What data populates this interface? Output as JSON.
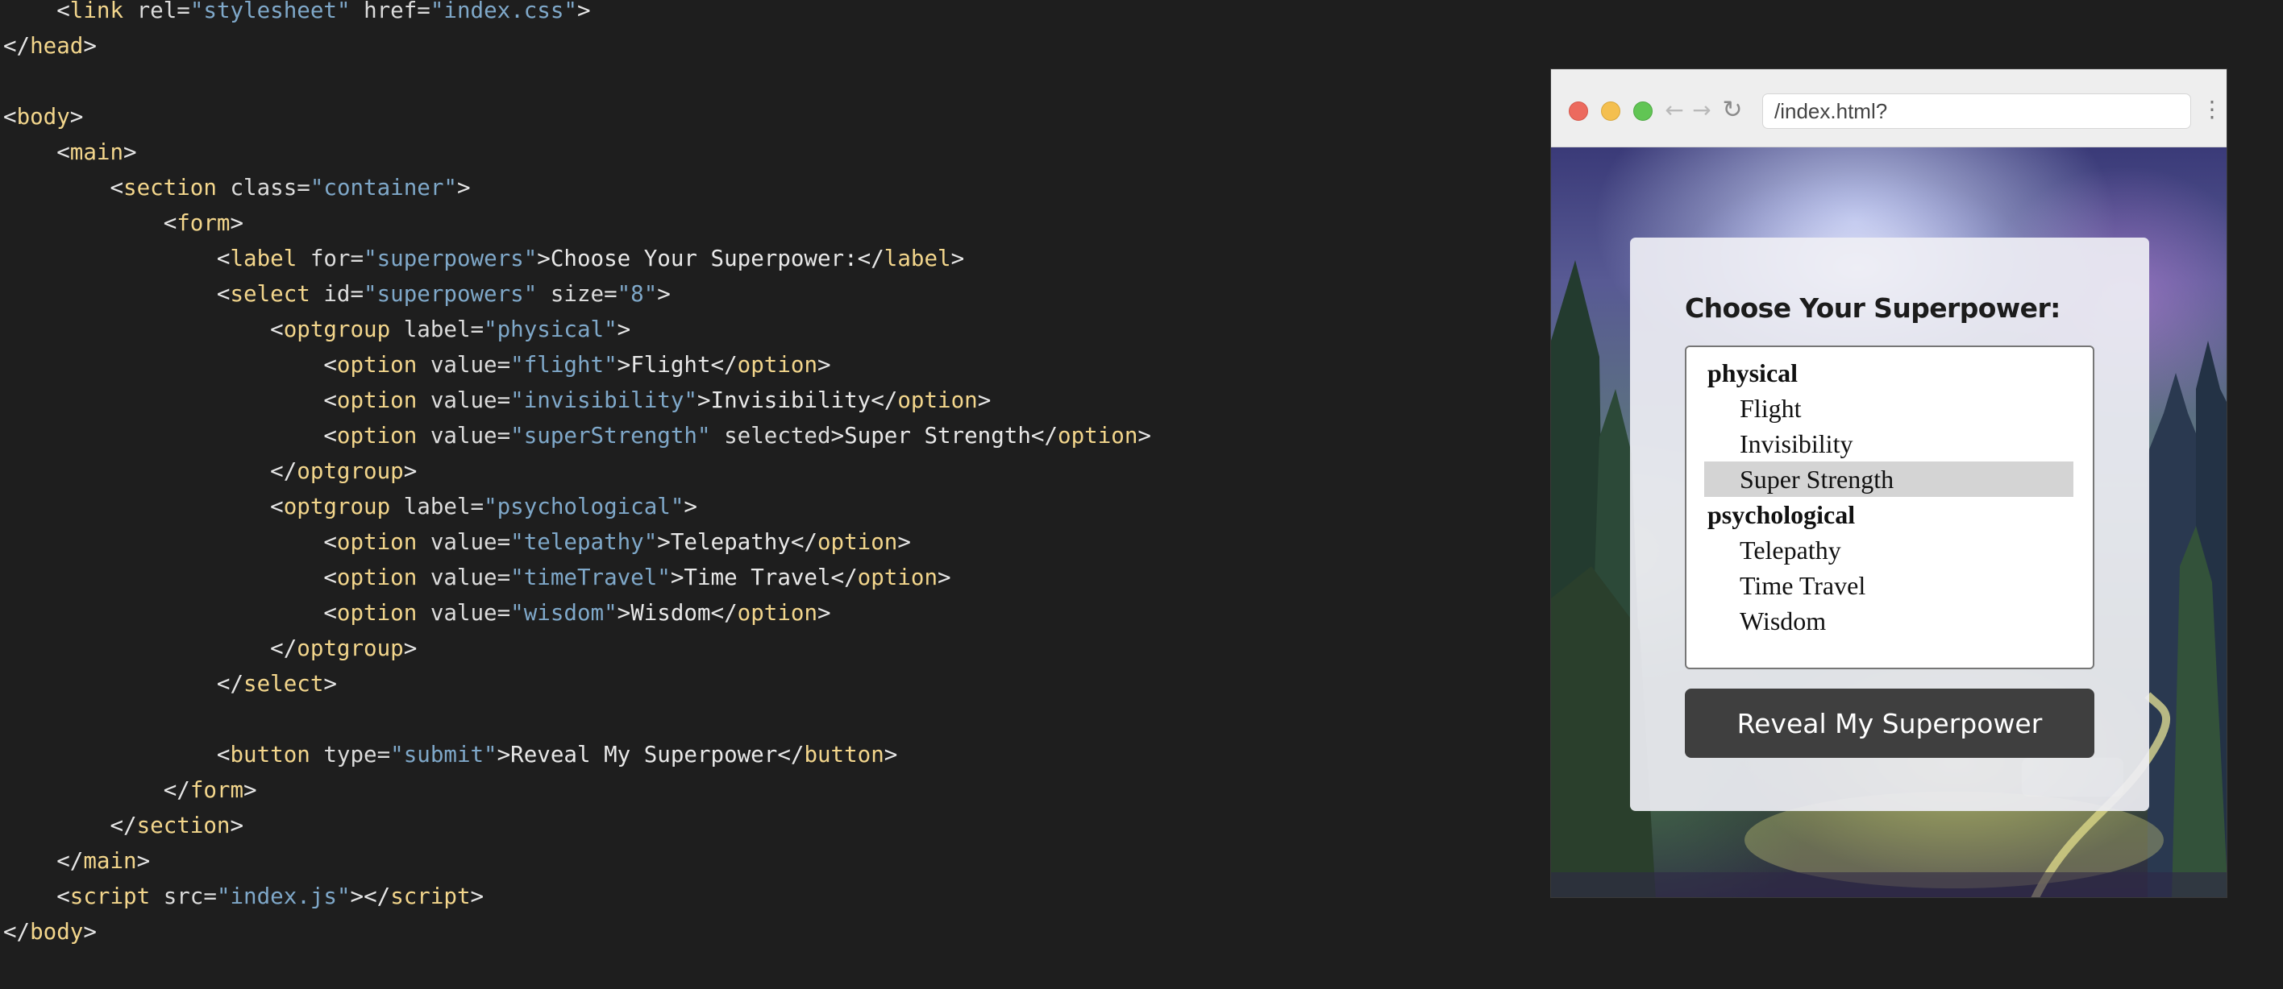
{
  "editor": {
    "lines": [
      {
        "indent": "    ",
        "tokens": [
          {
            "t": "punct",
            "v": "<"
          },
          {
            "t": "tag",
            "v": "link"
          },
          {
            "t": "attr",
            "v": " rel="
          },
          {
            "t": "str",
            "v": "\"stylesheet\""
          },
          {
            "t": "attr",
            "v": " href="
          },
          {
            "t": "str",
            "v": "\"index.css\""
          },
          {
            "t": "punct",
            "v": ">"
          }
        ]
      },
      {
        "indent": "",
        "tokens": [
          {
            "t": "punct",
            "v": "</"
          },
          {
            "t": "tag",
            "v": "head"
          },
          {
            "t": "punct",
            "v": ">"
          }
        ]
      },
      {
        "indent": "",
        "tokens": []
      },
      {
        "indent": "",
        "tokens": [
          {
            "t": "punct",
            "v": "<"
          },
          {
            "t": "tag",
            "v": "body"
          },
          {
            "t": "punct",
            "v": ">"
          }
        ]
      },
      {
        "indent": "    ",
        "tokens": [
          {
            "t": "punct",
            "v": "<"
          },
          {
            "t": "tag",
            "v": "main"
          },
          {
            "t": "punct",
            "v": ">"
          }
        ]
      },
      {
        "indent": "        ",
        "tokens": [
          {
            "t": "punct",
            "v": "<"
          },
          {
            "t": "tag",
            "v": "section"
          },
          {
            "t": "attr",
            "v": " class="
          },
          {
            "t": "str",
            "v": "\"container\""
          },
          {
            "t": "punct",
            "v": ">"
          }
        ]
      },
      {
        "indent": "            ",
        "tokens": [
          {
            "t": "punct",
            "v": "<"
          },
          {
            "t": "tag",
            "v": "form"
          },
          {
            "t": "punct",
            "v": ">"
          }
        ]
      },
      {
        "indent": "                ",
        "tokens": [
          {
            "t": "punct",
            "v": "<"
          },
          {
            "t": "tag",
            "v": "label"
          },
          {
            "t": "attr",
            "v": " for="
          },
          {
            "t": "str",
            "v": "\"superpowers\""
          },
          {
            "t": "punct",
            "v": ">"
          },
          {
            "t": "text",
            "v": "Choose Your Superpower:"
          },
          {
            "t": "punct",
            "v": "</"
          },
          {
            "t": "tag",
            "v": "label"
          },
          {
            "t": "punct",
            "v": ">"
          }
        ]
      },
      {
        "indent": "                ",
        "tokens": [
          {
            "t": "punct",
            "v": "<"
          },
          {
            "t": "tag",
            "v": "select"
          },
          {
            "t": "attr",
            "v": " id="
          },
          {
            "t": "str",
            "v": "\"superpowers\""
          },
          {
            "t": "attr",
            "v": " size="
          },
          {
            "t": "str",
            "v": "\"8\""
          },
          {
            "t": "punct",
            "v": ">"
          }
        ]
      },
      {
        "indent": "                    ",
        "tokens": [
          {
            "t": "punct",
            "v": "<"
          },
          {
            "t": "tag",
            "v": "optgroup"
          },
          {
            "t": "attr",
            "v": " label="
          },
          {
            "t": "str",
            "v": "\"physical\""
          },
          {
            "t": "punct",
            "v": ">"
          }
        ]
      },
      {
        "indent": "                        ",
        "tokens": [
          {
            "t": "punct",
            "v": "<"
          },
          {
            "t": "tag",
            "v": "option"
          },
          {
            "t": "attr",
            "v": " value="
          },
          {
            "t": "str",
            "v": "\"flight\""
          },
          {
            "t": "punct",
            "v": ">"
          },
          {
            "t": "text",
            "v": "Flight"
          },
          {
            "t": "punct",
            "v": "</"
          },
          {
            "t": "tag",
            "v": "option"
          },
          {
            "t": "punct",
            "v": ">"
          }
        ]
      },
      {
        "indent": "                        ",
        "tokens": [
          {
            "t": "punct",
            "v": "<"
          },
          {
            "t": "tag",
            "v": "option"
          },
          {
            "t": "attr",
            "v": " value="
          },
          {
            "t": "str",
            "v": "\"invisibility\""
          },
          {
            "t": "punct",
            "v": ">"
          },
          {
            "t": "text",
            "v": "Invisibility"
          },
          {
            "t": "punct",
            "v": "</"
          },
          {
            "t": "tag",
            "v": "option"
          },
          {
            "t": "punct",
            "v": ">"
          }
        ]
      },
      {
        "indent": "                        ",
        "tokens": [
          {
            "t": "punct",
            "v": "<"
          },
          {
            "t": "tag",
            "v": "option"
          },
          {
            "t": "attr",
            "v": " value="
          },
          {
            "t": "str",
            "v": "\"superStrength\""
          },
          {
            "t": "attr",
            "v": " selected"
          },
          {
            "t": "punct",
            "v": ">"
          },
          {
            "t": "text",
            "v": "Super Strength"
          },
          {
            "t": "punct",
            "v": "</"
          },
          {
            "t": "tag",
            "v": "option"
          },
          {
            "t": "punct",
            "v": ">"
          }
        ]
      },
      {
        "indent": "                    ",
        "tokens": [
          {
            "t": "punct",
            "v": "</"
          },
          {
            "t": "tag",
            "v": "optgroup"
          },
          {
            "t": "punct",
            "v": ">"
          }
        ]
      },
      {
        "indent": "                    ",
        "tokens": [
          {
            "t": "punct",
            "v": "<"
          },
          {
            "t": "tag",
            "v": "optgroup"
          },
          {
            "t": "attr",
            "v": " label="
          },
          {
            "t": "str",
            "v": "\"psychological\""
          },
          {
            "t": "punct",
            "v": ">"
          }
        ]
      },
      {
        "indent": "                        ",
        "tokens": [
          {
            "t": "punct",
            "v": "<"
          },
          {
            "t": "tag",
            "v": "option"
          },
          {
            "t": "attr",
            "v": " value="
          },
          {
            "t": "str",
            "v": "\"telepathy\""
          },
          {
            "t": "punct",
            "v": ">"
          },
          {
            "t": "text",
            "v": "Telepathy"
          },
          {
            "t": "punct",
            "v": "</"
          },
          {
            "t": "tag",
            "v": "option"
          },
          {
            "t": "punct",
            "v": ">"
          }
        ]
      },
      {
        "indent": "                        ",
        "tokens": [
          {
            "t": "punct",
            "v": "<"
          },
          {
            "t": "tag",
            "v": "option"
          },
          {
            "t": "attr",
            "v": " value="
          },
          {
            "t": "str",
            "v": "\"timeTravel\""
          },
          {
            "t": "punct",
            "v": ">"
          },
          {
            "t": "text",
            "v": "Time Travel"
          },
          {
            "t": "punct",
            "v": "</"
          },
          {
            "t": "tag",
            "v": "option"
          },
          {
            "t": "punct",
            "v": ">"
          }
        ]
      },
      {
        "indent": "                        ",
        "tokens": [
          {
            "t": "punct",
            "v": "<"
          },
          {
            "t": "tag",
            "v": "option"
          },
          {
            "t": "attr",
            "v": " value="
          },
          {
            "t": "str",
            "v": "\"wisdom\""
          },
          {
            "t": "punct",
            "v": ">"
          },
          {
            "t": "text",
            "v": "Wisdom"
          },
          {
            "t": "punct",
            "v": "</"
          },
          {
            "t": "tag",
            "v": "option"
          },
          {
            "t": "punct",
            "v": ">"
          }
        ]
      },
      {
        "indent": "                    ",
        "tokens": [
          {
            "t": "punct",
            "v": "</"
          },
          {
            "t": "tag",
            "v": "optgroup"
          },
          {
            "t": "punct",
            "v": ">"
          }
        ]
      },
      {
        "indent": "                ",
        "tokens": [
          {
            "t": "punct",
            "v": "</"
          },
          {
            "t": "tag",
            "v": "select"
          },
          {
            "t": "punct",
            "v": ">"
          }
        ]
      },
      {
        "indent": "",
        "tokens": []
      },
      {
        "indent": "                ",
        "tokens": [
          {
            "t": "punct",
            "v": "<"
          },
          {
            "t": "tag",
            "v": "button"
          },
          {
            "t": "attr",
            "v": " type="
          },
          {
            "t": "str",
            "v": "\"submit\""
          },
          {
            "t": "punct",
            "v": ">"
          },
          {
            "t": "text",
            "v": "Reveal My Superpower"
          },
          {
            "t": "punct",
            "v": "</"
          },
          {
            "t": "tag",
            "v": "button"
          },
          {
            "t": "punct",
            "v": ">"
          }
        ]
      },
      {
        "indent": "            ",
        "tokens": [
          {
            "t": "punct",
            "v": "</"
          },
          {
            "t": "tag",
            "v": "form"
          },
          {
            "t": "punct",
            "v": ">"
          }
        ]
      },
      {
        "indent": "        ",
        "tokens": [
          {
            "t": "punct",
            "v": "</"
          },
          {
            "t": "tag",
            "v": "section"
          },
          {
            "t": "punct",
            "v": ">"
          }
        ]
      },
      {
        "indent": "    ",
        "tokens": [
          {
            "t": "punct",
            "v": "</"
          },
          {
            "t": "tag",
            "v": "main"
          },
          {
            "t": "punct",
            "v": ">"
          }
        ]
      },
      {
        "indent": "    ",
        "tokens": [
          {
            "t": "punct",
            "v": "<"
          },
          {
            "t": "tag",
            "v": "script"
          },
          {
            "t": "attr",
            "v": " src="
          },
          {
            "t": "str",
            "v": "\"index.js\""
          },
          {
            "t": "punct",
            "v": "></"
          },
          {
            "t": "tag",
            "v": "script"
          },
          {
            "t": "punct",
            "v": ">"
          }
        ]
      },
      {
        "indent": "",
        "tokens": [
          {
            "t": "punct",
            "v": "</"
          },
          {
            "t": "tag",
            "v": "body"
          },
          {
            "t": "punct",
            "v": ">"
          }
        ]
      }
    ]
  },
  "browser": {
    "url": "/index.html?",
    "icons": {
      "back": "arrow-left-icon",
      "forward": "arrow-right-icon",
      "reload": "reload-icon",
      "menu": "kebab-menu-icon"
    }
  },
  "form": {
    "label": "Choose Your Superpower:",
    "listbox": {
      "items": [
        {
          "kind": "group",
          "text": "physical"
        },
        {
          "kind": "option",
          "text": "Flight"
        },
        {
          "kind": "option",
          "text": "Invisibility"
        },
        {
          "kind": "option",
          "text": "Super Strength",
          "selected": true
        },
        {
          "kind": "group",
          "text": "psychological"
        },
        {
          "kind": "option",
          "text": "Telepathy"
        },
        {
          "kind": "option",
          "text": "Time Travel"
        },
        {
          "kind": "option",
          "text": "Wisdom"
        }
      ]
    },
    "submit_label": "Reveal My Superpower"
  },
  "colors": {
    "editor_bg": "#1e1e1e",
    "tag": "#f3d68c",
    "string": "#7fa8c9",
    "button_bg": "#3f3f3f",
    "selected_option_bg": "#d4d4d4"
  }
}
